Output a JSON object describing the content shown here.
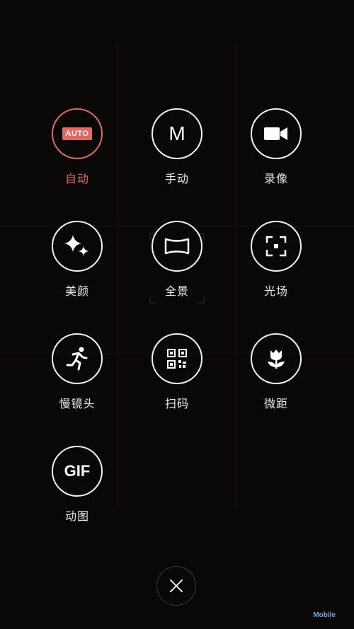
{
  "modes": [
    {
      "key": "auto",
      "label": "自动",
      "icon": "auto-badge-icon",
      "badge": "AUTO",
      "active": true
    },
    {
      "key": "manual",
      "label": "手动",
      "icon": "m-letter-icon",
      "glyph": "M",
      "active": false
    },
    {
      "key": "video",
      "label": "录像",
      "icon": "video-camera-icon",
      "active": false
    },
    {
      "key": "beauty",
      "label": "美颜",
      "icon": "sparkle-icon",
      "active": false
    },
    {
      "key": "panorama",
      "label": "全景",
      "icon": "panorama-icon",
      "active": false
    },
    {
      "key": "lightfield",
      "label": "光场",
      "icon": "focus-frame-icon",
      "active": false
    },
    {
      "key": "slowmo",
      "label": "慢镜头",
      "icon": "running-person-icon",
      "active": false
    },
    {
      "key": "scan",
      "label": "扫码",
      "icon": "qr-code-icon",
      "active": false
    },
    {
      "key": "macro",
      "label": "微距",
      "icon": "flower-icon",
      "active": false
    },
    {
      "key": "gif",
      "label": "动图",
      "icon": "gif-text-icon",
      "glyph": "GIF",
      "active": false
    }
  ],
  "close": {
    "icon": "close-icon"
  },
  "watermark": {
    "text": "Mobile"
  },
  "colors": {
    "accent": "#e06a5f",
    "ring": "#f2f2f2",
    "background": "#0a0707"
  }
}
